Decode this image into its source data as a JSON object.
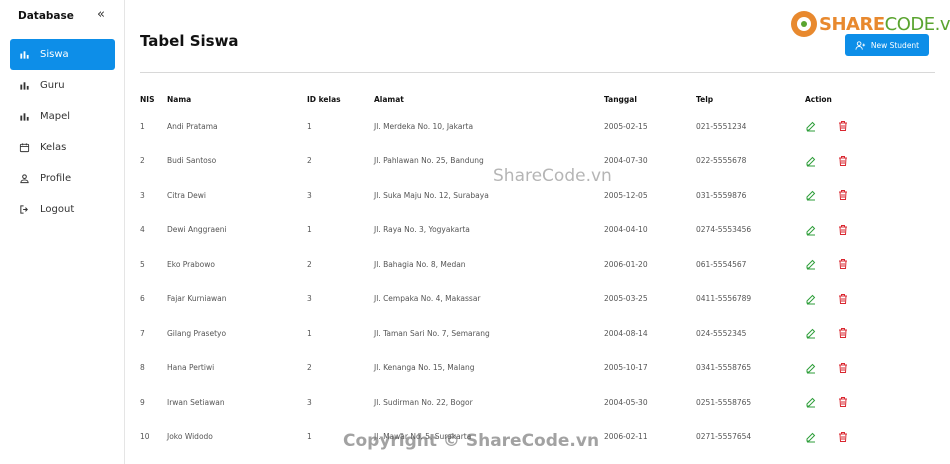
{
  "sidebar": {
    "title": "Database",
    "collapse_icon": "chevrons-left-icon",
    "items": [
      {
        "label": "Siswa",
        "icon": "bar-chart-icon",
        "active": true
      },
      {
        "label": "Guru",
        "icon": "bar-chart-icon",
        "active": false
      },
      {
        "label": "Mapel",
        "icon": "bar-chart-icon",
        "active": false
      },
      {
        "label": "Kelas",
        "icon": "calendar-icon",
        "active": false
      },
      {
        "label": "Profile",
        "icon": "user-icon",
        "active": false
      },
      {
        "label": "Logout",
        "icon": "logout-icon",
        "active": false
      }
    ]
  },
  "main": {
    "title": "Tabel Siswa",
    "new_button": "New Student",
    "logo": {
      "part1": "SHARE",
      "part2": "CODE.vn"
    },
    "watermark_center": "ShareCode.vn",
    "watermark_bottom": "Copyright © ShareCode.vn"
  },
  "table": {
    "headers": [
      "NIS",
      "Nama",
      "ID kelas",
      "Alamat",
      "Tanggal",
      "Telp",
      "Action"
    ],
    "rows": [
      [
        "1",
        "Andi Pratama",
        "1",
        "Jl. Merdeka No. 10, Jakarta",
        "2005-02-15",
        "021-5551234"
      ],
      [
        "2",
        "Budi Santoso",
        "2",
        "Jl. Pahlawan No. 25, Bandung",
        "2004-07-30",
        "022-5555678"
      ],
      [
        "3",
        "Citra Dewi",
        "3",
        "Jl. Suka Maju No. 12, Surabaya",
        "2005-12-05",
        "031-5559876"
      ],
      [
        "4",
        "Dewi Anggraeni",
        "1",
        "Jl. Raya No. 3, Yogyakarta",
        "2004-04-10",
        "0274-5553456"
      ],
      [
        "5",
        "Eko Prabowo",
        "2",
        "Jl. Bahagia No. 8, Medan",
        "2006-01-20",
        "061-5554567"
      ],
      [
        "6",
        "Fajar Kurniawan",
        "3",
        "Jl. Cempaka No. 4, Makassar",
        "2005-03-25",
        "0411-5556789"
      ],
      [
        "7",
        "Gilang Prasetyo",
        "1",
        "Jl. Taman Sari No. 7, Semarang",
        "2004-08-14",
        "024-5552345"
      ],
      [
        "8",
        "Hana Pertiwi",
        "2",
        "Jl. Kenanga No. 15, Malang",
        "2005-10-17",
        "0341-5558765"
      ],
      [
        "9",
        "Irwan Setiawan",
        "3",
        "Jl. Sudirman No. 22, Bogor",
        "2004-05-30",
        "0251-5558765"
      ],
      [
        "10",
        "Joko Widodo",
        "1",
        "Jl. Mawar No. 5, Surakarta",
        "2006-02-11",
        "0271-5557654"
      ]
    ],
    "edit_icon": "pencil-icon",
    "delete_icon": "trash-icon",
    "edit_color": "#2e9e3a",
    "delete_color": "#d9262f"
  },
  "colors": {
    "accent": "#0d8ee8",
    "logo_orange": "#e8892e",
    "logo_green": "#5aa42f"
  }
}
